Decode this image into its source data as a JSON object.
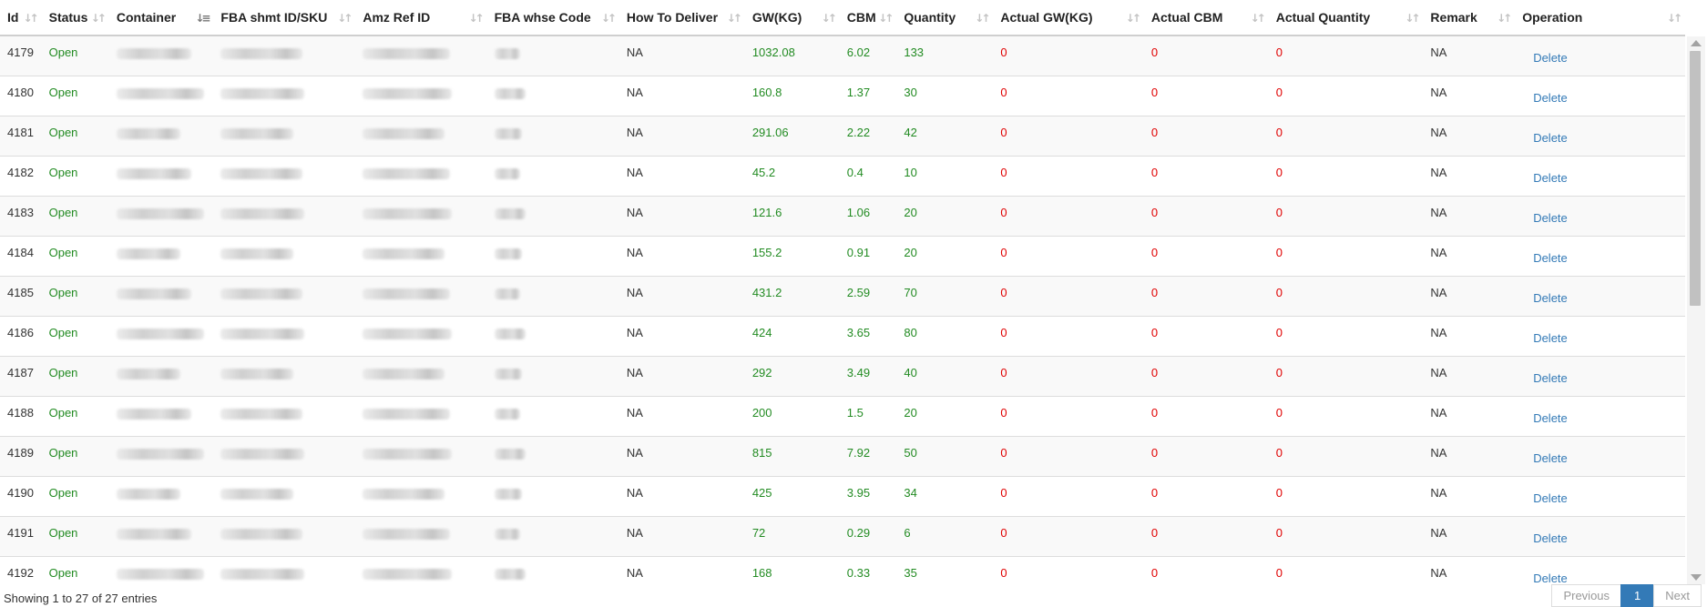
{
  "table": {
    "columns": [
      {
        "label": "Id"
      },
      {
        "label": "Status"
      },
      {
        "label": "Container"
      },
      {
        "label": "FBA shmt ID/SKU"
      },
      {
        "label": "Amz Ref ID"
      },
      {
        "label": "FBA whse Code"
      },
      {
        "label": "How To Deliver"
      },
      {
        "label": "GW(KG)"
      },
      {
        "label": "CBM"
      },
      {
        "label": "Quantity"
      },
      {
        "label": "Actual GW(KG)"
      },
      {
        "label": "Actual CBM"
      },
      {
        "label": "Actual Quantity"
      },
      {
        "label": "Remark"
      },
      {
        "label": "Operation"
      }
    ],
    "sorted_column": "Container",
    "rows": [
      {
        "id": "4179",
        "status": "Open",
        "deliver": "NA",
        "gw": "1032.08",
        "cbm": "6.02",
        "qty": "133",
        "agw": "0",
        "acbm": "0",
        "aqty": "0",
        "remark": "NA",
        "op": "Delete"
      },
      {
        "id": "4180",
        "status": "Open",
        "deliver": "NA",
        "gw": "160.8",
        "cbm": "1.37",
        "qty": "30",
        "agw": "0",
        "acbm": "0",
        "aqty": "0",
        "remark": "NA",
        "op": "Delete"
      },
      {
        "id": "4181",
        "status": "Open",
        "deliver": "NA",
        "gw": "291.06",
        "cbm": "2.22",
        "qty": "42",
        "agw": "0",
        "acbm": "0",
        "aqty": "0",
        "remark": "NA",
        "op": "Delete"
      },
      {
        "id": "4182",
        "status": "Open",
        "deliver": "NA",
        "gw": "45.2",
        "cbm": "0.4",
        "qty": "10",
        "agw": "0",
        "acbm": "0",
        "aqty": "0",
        "remark": "NA",
        "op": "Delete"
      },
      {
        "id": "4183",
        "status": "Open",
        "deliver": "NA",
        "gw": "121.6",
        "cbm": "1.06",
        "qty": "20",
        "agw": "0",
        "acbm": "0",
        "aqty": "0",
        "remark": "NA",
        "op": "Delete"
      },
      {
        "id": "4184",
        "status": "Open",
        "deliver": "NA",
        "gw": "155.2",
        "cbm": "0.91",
        "qty": "20",
        "agw": "0",
        "acbm": "0",
        "aqty": "0",
        "remark": "NA",
        "op": "Delete"
      },
      {
        "id": "4185",
        "status": "Open",
        "deliver": "NA",
        "gw": "431.2",
        "cbm": "2.59",
        "qty": "70",
        "agw": "0",
        "acbm": "0",
        "aqty": "0",
        "remark": "NA",
        "op": "Delete"
      },
      {
        "id": "4186",
        "status": "Open",
        "deliver": "NA",
        "gw": "424",
        "cbm": "3.65",
        "qty": "80",
        "agw": "0",
        "acbm": "0",
        "aqty": "0",
        "remark": "NA",
        "op": "Delete"
      },
      {
        "id": "4187",
        "status": "Open",
        "deliver": "NA",
        "gw": "292",
        "cbm": "3.49",
        "qty": "40",
        "agw": "0",
        "acbm": "0",
        "aqty": "0",
        "remark": "NA",
        "op": "Delete"
      },
      {
        "id": "4188",
        "status": "Open",
        "deliver": "NA",
        "gw": "200",
        "cbm": "1.5",
        "qty": "20",
        "agw": "0",
        "acbm": "0",
        "aqty": "0",
        "remark": "NA",
        "op": "Delete"
      },
      {
        "id": "4189",
        "status": "Open",
        "deliver": "NA",
        "gw": "815",
        "cbm": "7.92",
        "qty": "50",
        "agw": "0",
        "acbm": "0",
        "aqty": "0",
        "remark": "NA",
        "op": "Delete"
      },
      {
        "id": "4190",
        "status": "Open",
        "deliver": "NA",
        "gw": "425",
        "cbm": "3.95",
        "qty": "34",
        "agw": "0",
        "acbm": "0",
        "aqty": "0",
        "remark": "NA",
        "op": "Delete"
      },
      {
        "id": "4191",
        "status": "Open",
        "deliver": "NA",
        "gw": "72",
        "cbm": "0.29",
        "qty": "6",
        "agw": "0",
        "acbm": "0",
        "aqty": "0",
        "remark": "NA",
        "op": "Delete"
      },
      {
        "id": "4192",
        "status": "Open",
        "deliver": "NA",
        "gw": "168",
        "cbm": "0.33",
        "qty": "35",
        "agw": "0",
        "acbm": "0",
        "aqty": "0",
        "remark": "NA",
        "op": "Delete"
      }
    ]
  },
  "footer": {
    "info": "Showing 1 to 27 of 27 entries",
    "prev": "Previous",
    "page": "1",
    "next": "Next"
  },
  "icons": {
    "sort": "sort-both-icon",
    "sorted": "sort-asc-icon"
  },
  "colors": {
    "positive": "#228b22",
    "zero": "#e00000",
    "link": "#337ab7",
    "active_page": "#337ab7"
  }
}
